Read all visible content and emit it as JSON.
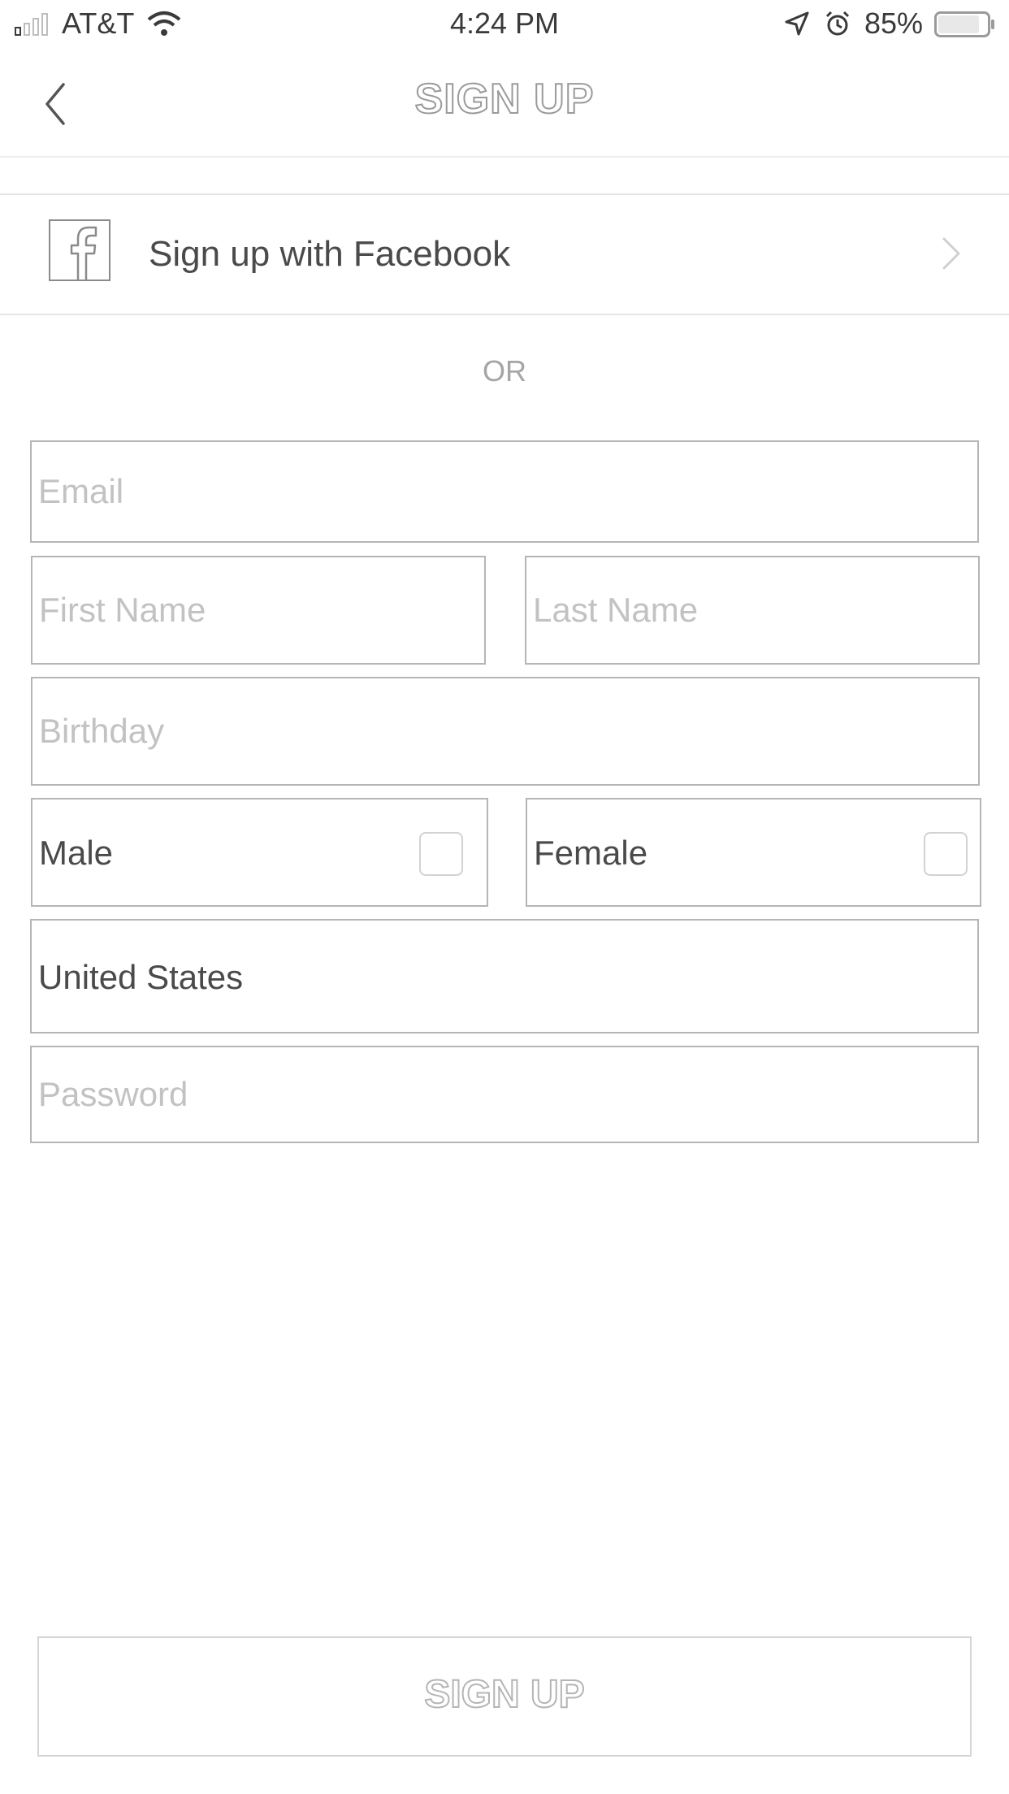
{
  "status_bar": {
    "carrier": "AT&T",
    "time": "4:24 PM",
    "battery_percent": "85%",
    "battery_level": 0.85,
    "icons": [
      "signal-icon",
      "wifi-icon",
      "location-icon",
      "alarm-icon",
      "battery-icon"
    ]
  },
  "nav": {
    "title": "SIGN UP",
    "back_icon": "chevron-left-icon"
  },
  "facebook": {
    "label": "Sign up with Facebook",
    "icon": "facebook-icon",
    "chevron_icon": "chevron-right-icon"
  },
  "divider_text": "OR",
  "form": {
    "email_placeholder": "Email",
    "first_name_placeholder": "First Name",
    "last_name_placeholder": "Last Name",
    "birthday_placeholder": "Birthday",
    "male_label": "Male",
    "female_label": "Female",
    "country_value": "United States",
    "password_placeholder": "Password"
  },
  "submit": {
    "label": "SIGN UP"
  },
  "colors": {
    "border": "#b5b5b5",
    "placeholder": "#c2c2c2",
    "text": "#4a4a4a"
  }
}
